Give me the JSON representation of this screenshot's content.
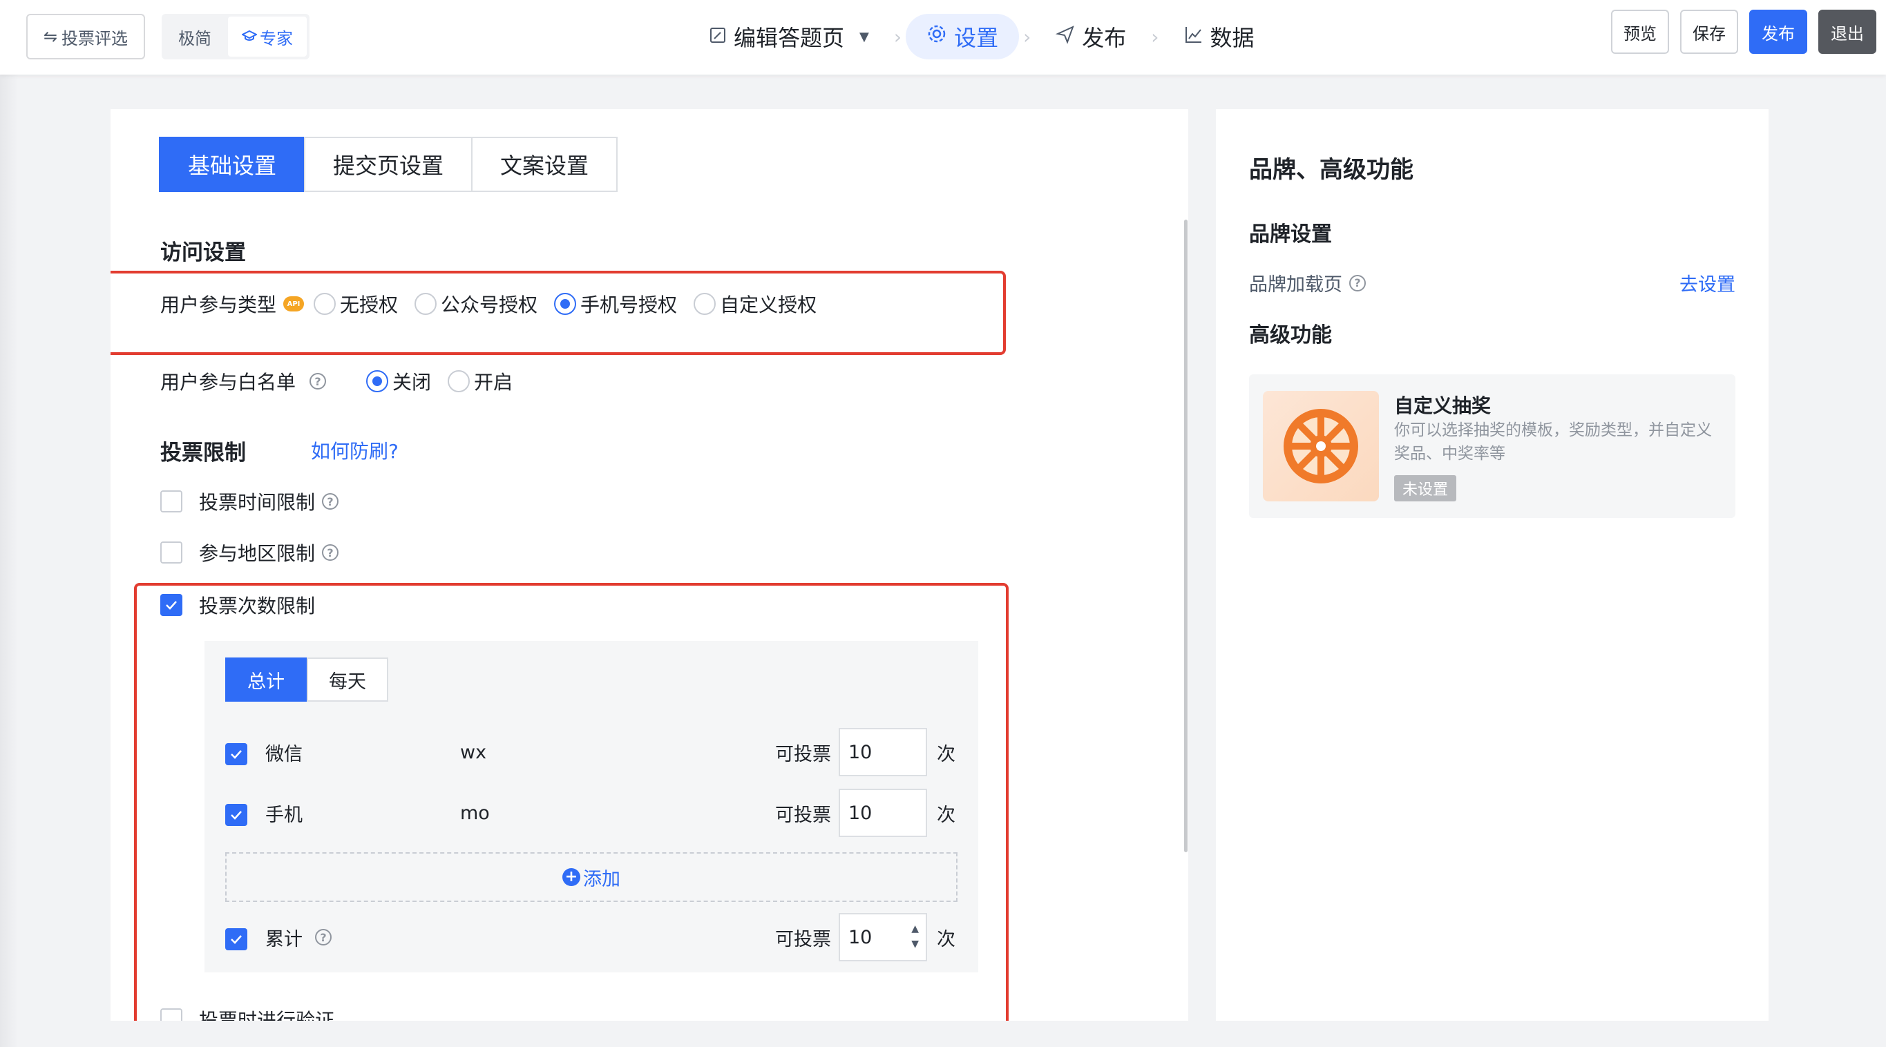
{
  "header": {
    "switch_label": "投票评选",
    "modes": [
      "极简",
      "专家"
    ],
    "steps": [
      "编辑答题页",
      "设置",
      "发布",
      "数据"
    ],
    "buttons": {
      "preview": "预览",
      "save": "保存",
      "publish": "发布",
      "exit": "退出"
    }
  },
  "tabs": [
    "基础设置",
    "提交页设置",
    "文案设置"
  ],
  "access": {
    "title": "访问设置",
    "user_type_label": "用户参与类型",
    "user_type_options": [
      "无授权",
      "公众号授权",
      "手机号授权",
      "自定义授权"
    ],
    "user_type_selected": "手机号授权",
    "whitelist_label": "用户参与白名单",
    "whitelist_options": [
      "关闭",
      "开启"
    ],
    "whitelist_selected": "关闭"
  },
  "vote_limit": {
    "title": "投票限制",
    "anti_fraud_link": "如何防刷?",
    "time_limit": "投票时间限制",
    "region_limit": "参与地区限制",
    "count_limit": "投票次数限制",
    "segments": [
      "总计",
      "每天"
    ],
    "rows": [
      {
        "name": "微信",
        "code": "wx",
        "can_vote": "可投票",
        "value": "10",
        "unit": "次"
      },
      {
        "name": "手机",
        "code": "mo",
        "can_vote": "可投票",
        "value": "10",
        "unit": "次"
      }
    ],
    "add_label": "添加",
    "total": {
      "name": "累计",
      "can_vote": "可投票",
      "value": "10",
      "unit": "次"
    },
    "verify_label": "投票时进行验证"
  },
  "right": {
    "title": "品牌、高级功能",
    "brand_title": "品牌设置",
    "brand_loading": "品牌加载页",
    "go_setting": "去设置",
    "advanced_title": "高级功能",
    "card": {
      "title": "自定义抽奖",
      "desc": "你可以选择抽奖的模板，奖励类型，并自定义奖品、中奖率等",
      "tag": "未设置"
    }
  },
  "colors": {
    "primary": "#2f6cf6",
    "highlight": "#e23c30"
  }
}
